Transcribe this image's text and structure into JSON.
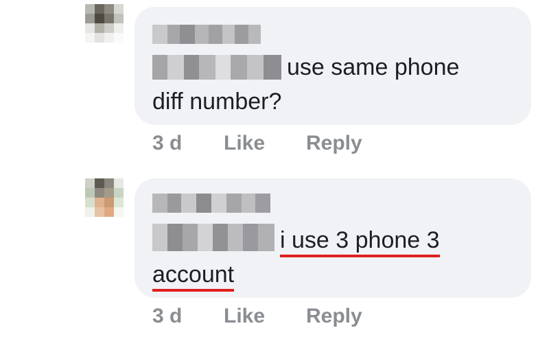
{
  "comments": [
    {
      "line1": "use same phone",
      "line2": "diff number?",
      "time": "3 d",
      "like": "Like",
      "reply": "Reply"
    },
    {
      "line1": "i use 3 phone 3",
      "line2": "account",
      "time": "3 d",
      "like": "Like",
      "reply": "Reply"
    }
  ],
  "colors": {
    "bubble": "#f0f2f5",
    "meta": "#8a8d91",
    "underline": "#e01e1e"
  }
}
